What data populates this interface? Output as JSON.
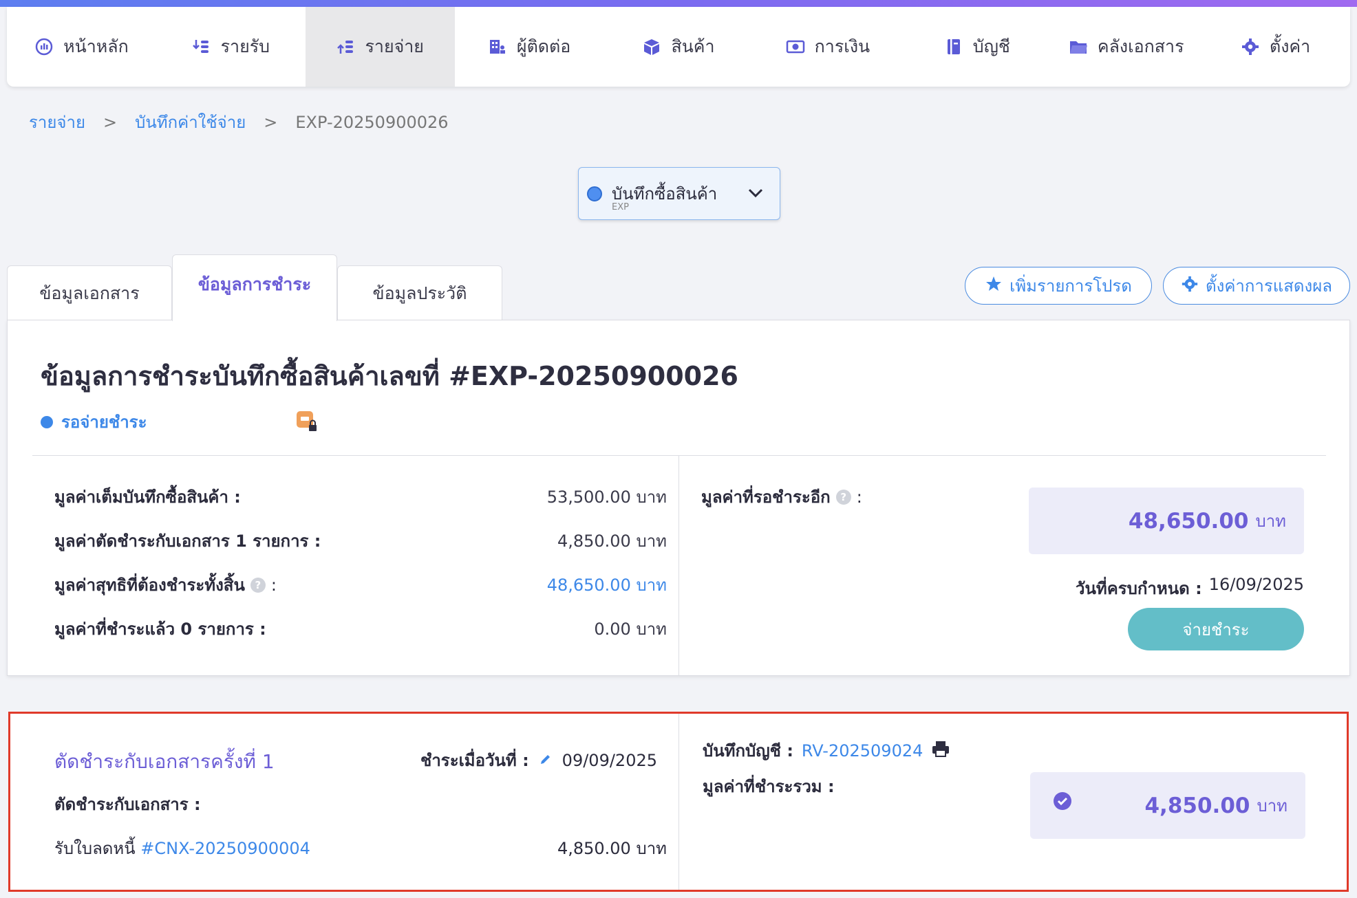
{
  "nav": {
    "items": [
      {
        "label": "หน้าหลัก",
        "icon": "dashboard-icon"
      },
      {
        "label": "รายรับ",
        "icon": "income-icon"
      },
      {
        "label": "รายจ่าย",
        "icon": "expense-icon",
        "active": true
      },
      {
        "label": "ผู้ติดต่อ",
        "icon": "contacts-icon"
      },
      {
        "label": "สินค้า",
        "icon": "box-icon"
      },
      {
        "label": "การเงิน",
        "icon": "money-icon"
      },
      {
        "label": "บัญชี",
        "icon": "book-icon"
      },
      {
        "label": "คลังเอกสาร",
        "icon": "folder-icon"
      },
      {
        "label": "ตั้งค่า",
        "icon": "gear-icon"
      }
    ]
  },
  "breadcrumb": {
    "items": [
      "รายจ่าย",
      "บันทึกค่าใช้จ่าย"
    ],
    "separator": ">",
    "current": "EXP-20250900026"
  },
  "doc_type": {
    "title": "บันทึกซื้อสินค้า",
    "code": "EXP"
  },
  "tabs": [
    {
      "label": "ข้อมูลเอกสาร"
    },
    {
      "label": "ข้อมูลการชำระ",
      "active": true
    },
    {
      "label": "ข้อมูลประวัติ"
    }
  ],
  "actions": {
    "favorite_label": "เพิ่มรายการโปรด",
    "display_settings_label": "ตั้งค่าการแสดงผล"
  },
  "payment_info": {
    "heading": "ข้อมูลการชำระบันทึกซื้อสินค้าเลขที่ #EXP-20250900026",
    "status": "รอจ่ายชำระ",
    "summary": [
      {
        "label": "มูลค่าเต็มบันทึกซื้อสินค้า :",
        "value": "53,500.00 บาท"
      },
      {
        "label": "มูลค่าตัดชำระกับเอกสาร 1 รายการ :",
        "value": "4,850.00 บาท"
      },
      {
        "label": "มูลค่าสุทธิที่ต้องชำระทั้งสิ้น",
        "suffix": ":",
        "value": "48,650.00 บาท",
        "help": true
      },
      {
        "label": "มูลค่าที่ชำระแล้ว 0 รายการ :",
        "value": "0.00 บาท"
      }
    ],
    "remaining_label": "มูลค่าที่รอชำระอีก",
    "remaining_suffix": ":",
    "remaining_amount": "48,650.00",
    "currency": "บาท",
    "due_label": "วันที่ครบกำหนด :",
    "due_date": "16/09/2025",
    "pay_button": "จ่ายชำระ"
  },
  "settlement": {
    "title": "ตัดชำระกับเอกสารครั้งที่ 1",
    "paid_on_label": "ชำระเมื่อวันที่ :",
    "paid_on_date": "09/09/2025",
    "with_docs_label": "ตัดชำระกับเอกสาร :",
    "doc_prefix": "รับใบลดหนี้",
    "doc_number": "#CNX-20250900004",
    "doc_amount": "4,850.00 บาท",
    "account_label": "บันทึกบัญชี :",
    "account_number": "RV-202509024",
    "total_label": "มูลค่าที่ชำระรวม :",
    "total_amount": "4,850.00",
    "currency": "บาท"
  },
  "colors": {
    "accent": "#6c5ed6",
    "link": "#3d88e8",
    "pay_button": "#63bec8",
    "highlight_border": "#e03a2a"
  }
}
